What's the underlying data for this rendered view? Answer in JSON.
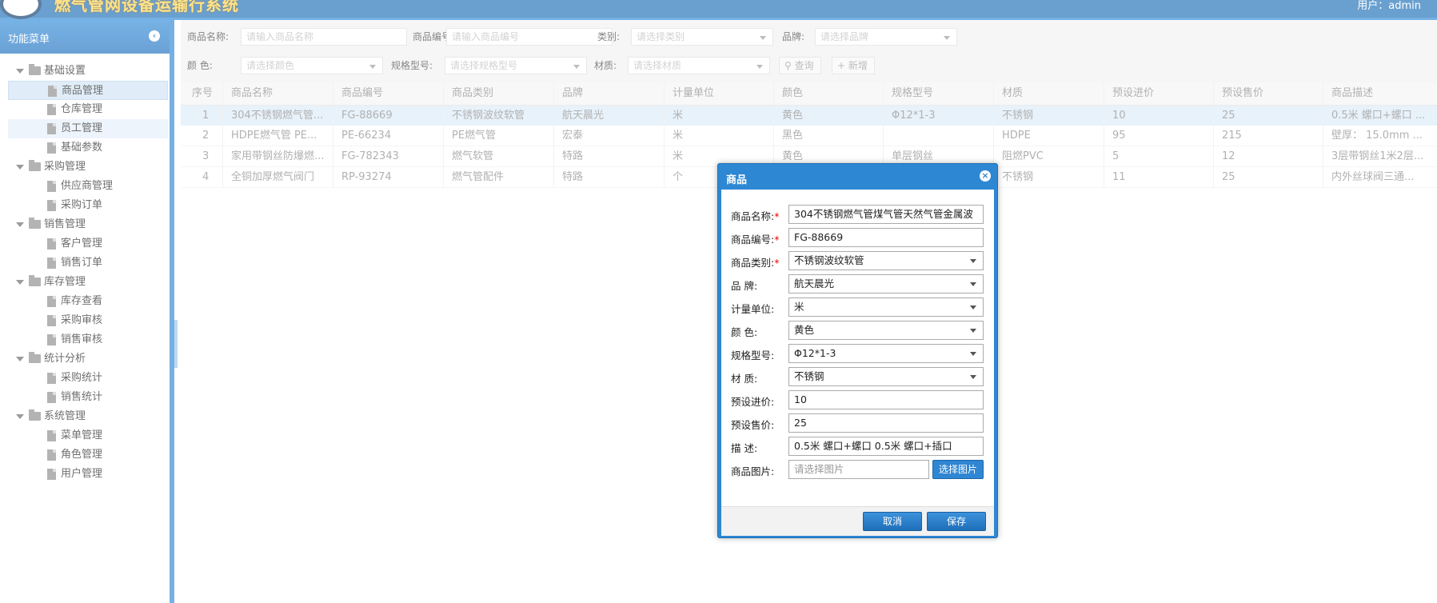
{
  "header": {
    "title": "燃气管网设备运输行系统",
    "user_label": "用户：admin"
  },
  "sidebar": {
    "title": "功能菜单",
    "groups": [
      {
        "label": "基础设置",
        "items": [
          "商品管理",
          "仓库管理",
          "员工管理",
          "基础参数"
        ]
      },
      {
        "label": "采购管理",
        "items": [
          "供应商管理",
          "采购订单"
        ]
      },
      {
        "label": "销售管理",
        "items": [
          "客户管理",
          "销售订单"
        ]
      },
      {
        "label": "库存管理",
        "items": [
          "库存查看",
          "采购审核",
          "销售审核"
        ]
      },
      {
        "label": "统计分析",
        "items": [
          "采购统计",
          "销售统计"
        ]
      },
      {
        "label": "系统管理",
        "items": [
          "菜单管理",
          "角色管理",
          "用户管理"
        ]
      }
    ]
  },
  "filters": {
    "name_label": "商品名称:",
    "name_placeholder": "请输入商品名称",
    "code_label": "商品编号:",
    "code_placeholder": "请输入商品编号",
    "category_label": "类别:",
    "category_placeholder": "请选择类别",
    "brand_label": "品牌:",
    "brand_placeholder": "请选择品牌",
    "color_label": "颜 色:",
    "color_placeholder": "请选择颜色",
    "spec_label": "规格型号:",
    "spec_placeholder": "请选择规格型号",
    "material_label": "材质:",
    "material_placeholder": "请选择材质",
    "search_label": "查询",
    "add_label": "新增"
  },
  "grid": {
    "columns": [
      "序号",
      "商品名称",
      "商品编号",
      "商品类别",
      "品牌",
      "计量单位",
      "颜色",
      "规格型号",
      "材质",
      "预设进价",
      "预设售价",
      "商品描述"
    ],
    "rows": [
      [
        "1",
        "304不锈钢燃气管...",
        "FG-88669",
        "不锈钢波纹软管",
        "航天晨光",
        "米",
        "黄色",
        "Φ12*1-3",
        "不锈钢",
        "10",
        "25",
        "0.5米 螺口+螺口 ..."
      ],
      [
        "2",
        "HDPE燃气管 PE...",
        "PE-66234",
        "PE燃气管",
        "宏泰",
        "米",
        "黑色",
        "",
        "HDPE",
        "95",
        "215",
        "壁厚： 15.0mm ..."
      ],
      [
        "3",
        "家用带钢丝防爆燃...",
        "FG-782343",
        "燃气软管",
        "特路",
        "米",
        "黄色",
        "单层钢丝",
        "阻燃PVC",
        "5",
        "12",
        "3层带钢丝1米2层..."
      ],
      [
        "4",
        "全铜加厚燃气阀门",
        "RP-93274",
        "燃气管配件",
        "特路",
        "个",
        "",
        "",
        "不锈钢",
        "11",
        "25",
        "内外丝球阀三通..."
      ]
    ]
  },
  "dialog": {
    "title": "商品",
    "fields": [
      {
        "label": "商品名称:",
        "required": "*",
        "value": "304不锈钢燃气管煤气管天然气管金属波"
      },
      {
        "label": "商品编号:",
        "required": "*",
        "value": "FG-88669"
      },
      {
        "label": "商品类别:",
        "required": "*",
        "value": "不锈钢波纹软管"
      },
      {
        "label": "品 牌:",
        "required": "",
        "value": "航天晨光"
      },
      {
        "label": "计量单位:",
        "required": "",
        "value": "米"
      },
      {
        "label": "颜 色:",
        "required": "",
        "value": "黄色"
      },
      {
        "label": "规格型号:",
        "required": "",
        "value": "Φ12*1-3"
      },
      {
        "label": "材 质:",
        "required": "",
        "value": "不锈钢"
      },
      {
        "label": "预设进价:",
        "required": "",
        "value": "10"
      },
      {
        "label": "预设售价:",
        "required": "",
        "value": "25"
      },
      {
        "label": "描 述:",
        "required": "",
        "value": "0.5米 螺口+螺口 0.5米 螺口+插口"
      }
    ],
    "image_label": "商品图片:",
    "image_placeholder": "请选择图片",
    "pick_button": "选择图片",
    "cancel_button": "取消",
    "save_button": "保存"
  }
}
